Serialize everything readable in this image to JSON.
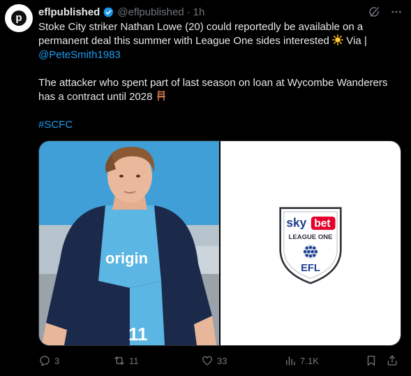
{
  "account": {
    "avatar_letter": "p",
    "name": "eflpublished",
    "handle": "@eflpublished",
    "separator": "·",
    "time": "1h"
  },
  "icons": {
    "verified": "verified-badge-icon",
    "grok": "grok-icon",
    "more": "more-icon",
    "sun_emoji": "sun-emoji-icon",
    "chair_emoji": "chair-emoji-icon"
  },
  "tweet": {
    "line1": "Stoke City striker Nathan Lowe (20) could reportedly be available on a permanent deal this summer with League One sides interested",
    "via": "Via |",
    "mention": "@PeteSmith1983",
    "line2": "The attacker who spent part of last season on loan at Wycombe Wanderers has a contract until 2028",
    "hashtag": "#SCFC"
  },
  "media": {
    "shirt_sponsor": "origin",
    "shirt_number": "11",
    "logo": {
      "sky": "sky",
      "bet": "bet",
      "league": "LEAGUE ONE",
      "efl": "EFL"
    }
  },
  "actions": {
    "replies": "3",
    "reposts": "11",
    "likes": "33",
    "views": "7.1K"
  },
  "colors": {
    "background": "#000000",
    "text": "#e7e9ea",
    "muted": "#71767b",
    "link": "#1d9bf0",
    "verified": "#1d9bf0",
    "bet_red": "#e4002b"
  }
}
